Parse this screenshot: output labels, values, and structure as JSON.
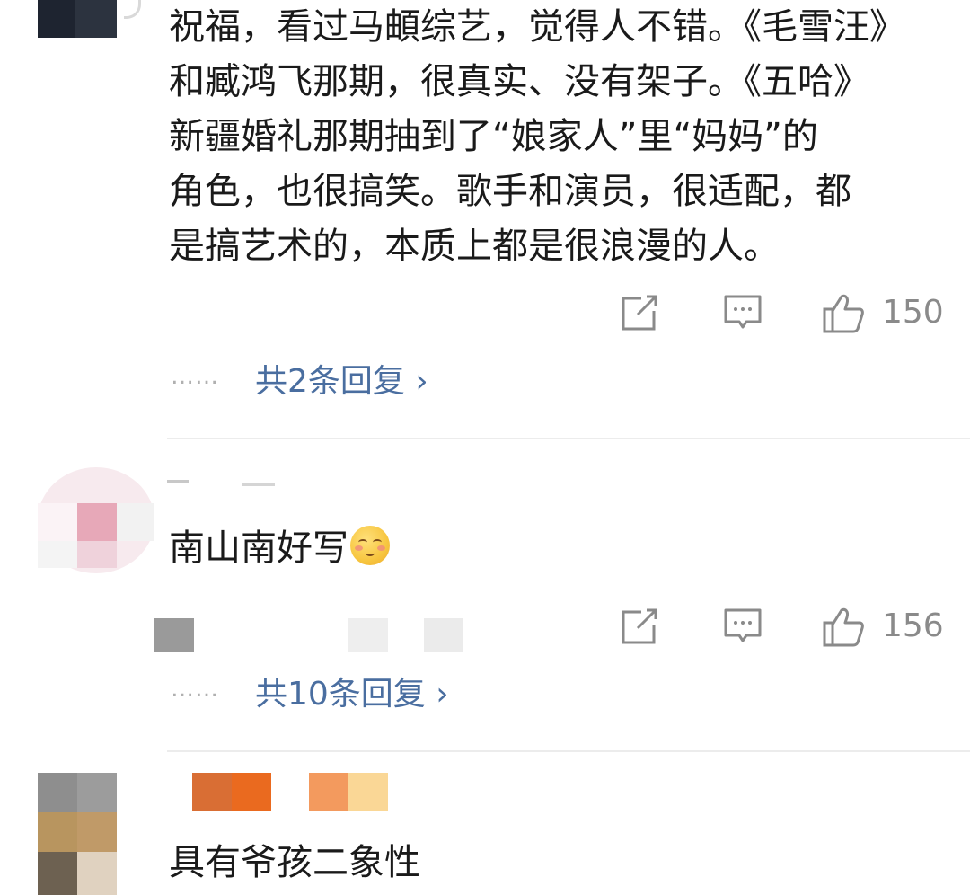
{
  "comments": [
    {
      "text_lines": [
        "祝福，看过马頔综艺，觉得人不错。《毛雪汪》",
        "和臧鸿飞那期，很真实、没有架子。《五哈》",
        "新疆婚礼那期抽到了“娘家人”里“妈妈”的",
        "角色，也很搞笑。歌手和演员，很适配，都",
        "是搞艺术的，本质上都是很浪漫的人。"
      ],
      "like_count": "150",
      "replies_label": "共2条回复 ›"
    },
    {
      "text": "南山南好写",
      "emoji": "blushing-smile-emoji",
      "like_count": "156",
      "replies_label": "共10条回复 ›"
    },
    {
      "text": "具有爷孩二象性"
    }
  ],
  "icons": {
    "share": "share-icon",
    "comment": "comment-icon",
    "like": "thumbs-up-icon"
  },
  "ellipsis": "……",
  "colors": {
    "text": "#1a1a1a",
    "meta": "#8a8a8a",
    "link": "#4a6ea0",
    "divider": "#ececec"
  }
}
